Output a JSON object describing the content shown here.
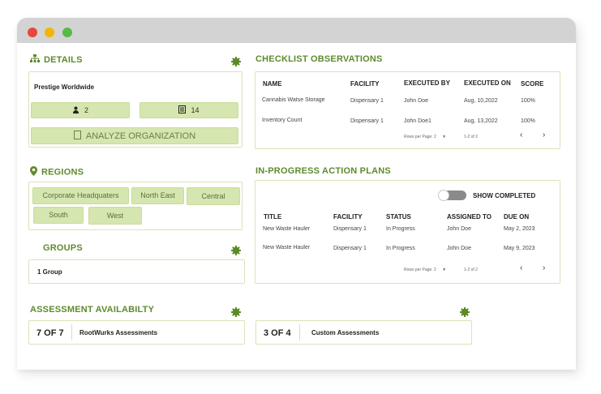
{
  "details": {
    "heading": "DETAILS",
    "org_name": "Prestige Worldwide",
    "users_count": "2",
    "docs_count": "14",
    "analyze_label": "ANALYZE ORGANIZATION"
  },
  "regions": {
    "heading": "REGIONS",
    "items": [
      "Corporate Headquaters",
      "North East",
      "Central",
      "South",
      "West"
    ]
  },
  "groups": {
    "heading": "GROUPS",
    "value": "1 Group"
  },
  "assessment": {
    "heading": "ASSESSMENT AVAILABILTY",
    "cards": [
      {
        "count": "7 OF 7",
        "label": "RootWurks Assessments"
      },
      {
        "count": "3 OF 4",
        "label": "Custom Assessments"
      }
    ]
  },
  "checklist": {
    "heading": "CHECKLIST OBSERVATIONS",
    "columns": [
      "NAME",
      "FACILITY",
      "EXECUTED BY",
      "EXECUTED ON",
      "SCORE"
    ],
    "rows": [
      [
        "Cannabis Watse Storage",
        "Dispensary 1",
        "John Doe",
        "Aug, 10,2022",
        "100%"
      ],
      [
        "Inventory Count",
        "Dispensary 1",
        "John Doe1",
        "Aug, 13,2022",
        "100%"
      ]
    ],
    "rows_per_page": "Rows per Page: 2",
    "range": "1-2 of 2",
    "prev": "‹",
    "next": "›"
  },
  "action_plans": {
    "heading": "IN-PROGRESS ACTION PLANS",
    "toggle_label": "SHOW COMPLETED",
    "columns": [
      "TITLE",
      "FACILITY",
      "STATUS",
      "ASSIGNED TO",
      "DUE ON"
    ],
    "rows": [
      [
        "New Waste Hauler",
        "Dispensary 1",
        "In Progress",
        "John Doe",
        "May 2, 2023"
      ],
      [
        "New Waste Hauler",
        "Dispensary 1",
        "In Progress",
        "John Doe",
        "May 9, 2023"
      ]
    ],
    "rows_per_page": "Rows per Page: 2",
    "range": "1-2 of 2",
    "prev": "‹",
    "next": "›"
  },
  "colors": {
    "accent": "#5f8a2d",
    "pill_bg": "#d6e6b0",
    "border": "#d9e3b8",
    "titlebar": "#d3d3d3"
  },
  "icons": [
    "sitemap-icon",
    "gear-icon",
    "user-icon",
    "document-icon",
    "square-icon",
    "map-pin-icon",
    "chevron-left-icon",
    "chevron-right-icon"
  ]
}
